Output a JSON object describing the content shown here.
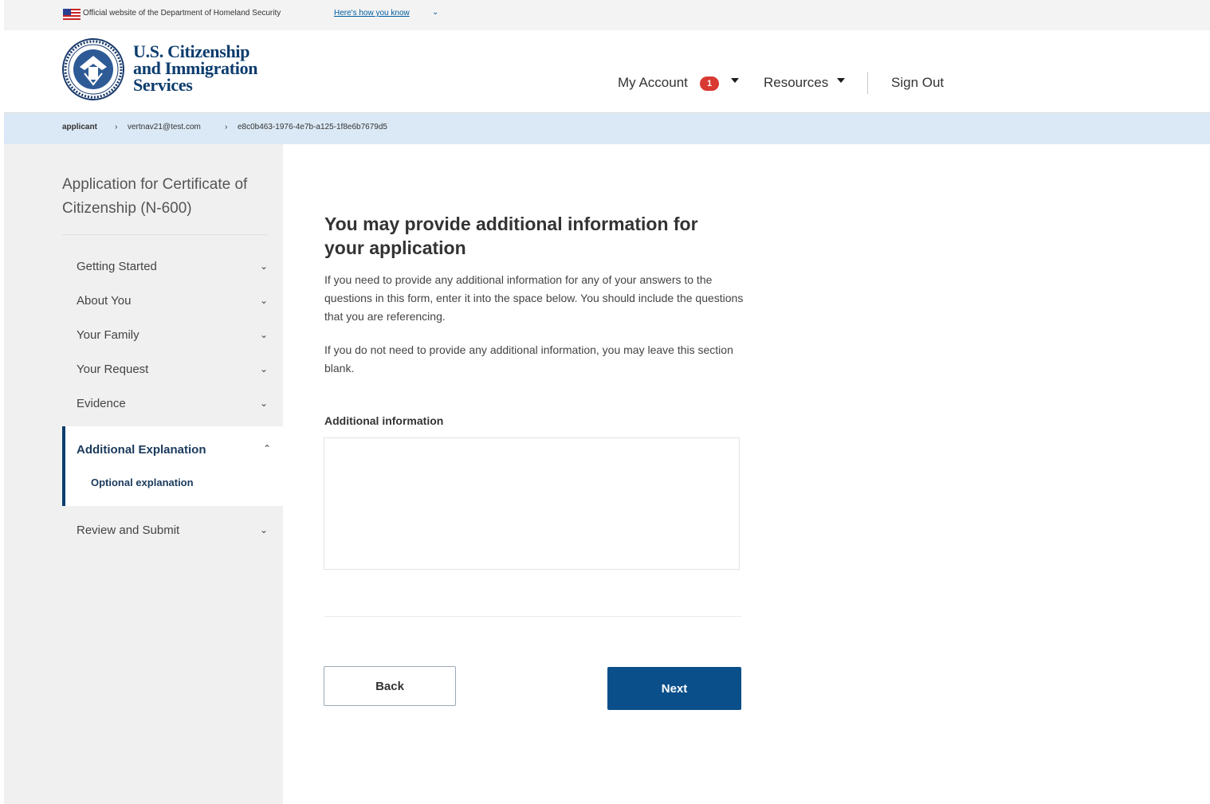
{
  "banner": {
    "text": "Official website of the Department of Homeland Security",
    "link": "Here's how you know"
  },
  "header": {
    "agency_line1": "U.S. Citizenship",
    "agency_line2": "and Immigration",
    "agency_line3": "Services",
    "nav": {
      "my_account": "My Account",
      "notification_count": "1",
      "resources": "Resources",
      "sign_out": "Sign Out"
    }
  },
  "breadcrumb": {
    "items": [
      "applicant",
      "vertnav21@test.com",
      "e8c0b463-1976-4e7b-a125-1f8e6b7679d5"
    ],
    "separator": "›"
  },
  "sidebar": {
    "title": "Application for Certificate of Citizenship (N-600)",
    "items": [
      {
        "label": "Getting Started"
      },
      {
        "label": "About You"
      },
      {
        "label": "Your Family"
      },
      {
        "label": "Your Request"
      },
      {
        "label": "Evidence"
      },
      {
        "label": "Additional Explanation",
        "active": true,
        "sub": "Optional explanation"
      },
      {
        "label": "Review and Submit"
      }
    ]
  },
  "main": {
    "heading": "You may provide additional information for your application",
    "para1": "If you need to provide any additional information for any of your answers to the questions in this form, enter it into the space below. You should include the questions that you are referencing.",
    "para2": "If you do not need to provide any additional information, you may leave this section blank.",
    "field_label": "Additional information",
    "field_value": "",
    "back_label": "Back",
    "next_label": "Next"
  },
  "colors": {
    "primary": "#0b4f8a",
    "breadcrumb_bg": "#dbe9f6",
    "sidebar_bg": "#f0f0f0",
    "badge": "#d83933"
  }
}
